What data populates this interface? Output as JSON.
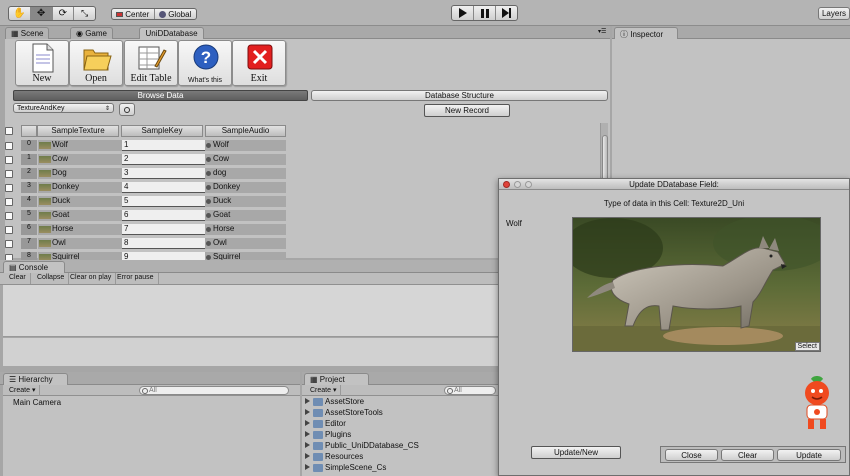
{
  "toolbar": {
    "tools": [
      "hand-icon",
      "move-icon",
      "rotate-icon",
      "scale-icon"
    ],
    "pivot_label": "Center",
    "space_label": "Global",
    "layers_label": "Layers"
  },
  "tabs": {
    "scene": "Scene",
    "game": "Game",
    "unidb": "UniDDatabase",
    "inspector": "Inspector"
  },
  "unidb": {
    "buttons": [
      {
        "label": "New",
        "icon": "new-file-icon"
      },
      {
        "label": "Open",
        "icon": "open-folder-icon"
      },
      {
        "label": "Edit Table",
        "icon": "edit-table-icon"
      },
      {
        "label": "What's this",
        "icon": "help-icon"
      },
      {
        "label": "Exit",
        "icon": "exit-icon"
      }
    ],
    "browse_data": "Browse Data",
    "database_structure": "Database Structure",
    "table_select": "TextureAndKey",
    "new_record": "New Record",
    "columns": [
      "SampleTexture",
      "SampleKey",
      "SampleAudio"
    ],
    "rows": [
      {
        "index": "0",
        "texture": "Wolf",
        "key": "1",
        "audio": "Wolf"
      },
      {
        "index": "1",
        "texture": "Cow",
        "key": "2",
        "audio": "Cow"
      },
      {
        "index": "2",
        "texture": "Dog",
        "key": "3",
        "audio": "dog"
      },
      {
        "index": "3",
        "texture": "Donkey",
        "key": "4",
        "audio": "Donkey"
      },
      {
        "index": "4",
        "texture": "Duck",
        "key": "5",
        "audio": "Duck"
      },
      {
        "index": "5",
        "texture": "Goat",
        "key": "6",
        "audio": "Goat"
      },
      {
        "index": "6",
        "texture": "Horse",
        "key": "7",
        "audio": "Horse"
      },
      {
        "index": "7",
        "texture": "Owl",
        "key": "8",
        "audio": "Owl"
      },
      {
        "index": "8",
        "texture": "Squirrel",
        "key": "9",
        "audio": "Squirrel"
      }
    ]
  },
  "console": {
    "title": "Console",
    "buttons": [
      "Clear",
      "Collapse",
      "Clear on play",
      "Error pause"
    ]
  },
  "hierarchy": {
    "title": "Hierarchy",
    "create": "Create",
    "search_placeholder": "All",
    "items": [
      "Main Camera"
    ]
  },
  "project": {
    "title": "Project",
    "create": "Create",
    "search_placeholder": "All",
    "folders": [
      "AssetStore",
      "AssetStoreTools",
      "Editor",
      "Plugins",
      "Public_UniDDatabase_CS",
      "Resources",
      "SimpleScene_Cs"
    ]
  },
  "dialog": {
    "title": "Update DDatabase Field:",
    "type_text": "Type of data in this Cell: Texture2D_Uni",
    "field_name": "Wolf",
    "select_label": "Select",
    "update_new": "Update/New",
    "close": "Close",
    "clear": "Clear",
    "update": "Update"
  }
}
